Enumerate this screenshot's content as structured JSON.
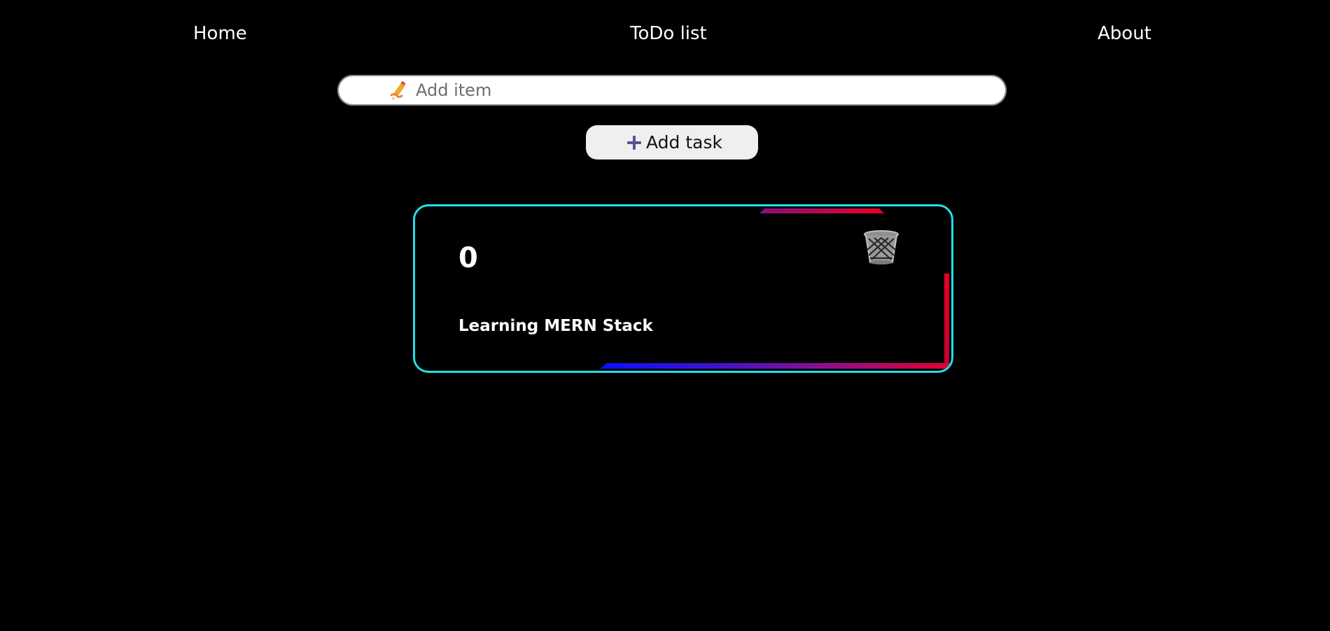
{
  "nav": {
    "home_label": "Home",
    "title_label": "ToDo list",
    "about_label": "About"
  },
  "add_item": {
    "placeholder": "Add item",
    "value": "",
    "icon": "pencil-writing-icon"
  },
  "add_task_button": {
    "label": "Add task",
    "icon": "plus-icon",
    "icon_color": "#5b4f9a"
  },
  "tasks": [
    {
      "index": "0",
      "text": "Learning MERN Stack",
      "delete_icon": "trash-basket-icon"
    }
  ],
  "colors": {
    "background": "#000000",
    "card_border": "#22dfe8",
    "accent_red": "#e80022",
    "accent_blue": "#0a10ff"
  }
}
